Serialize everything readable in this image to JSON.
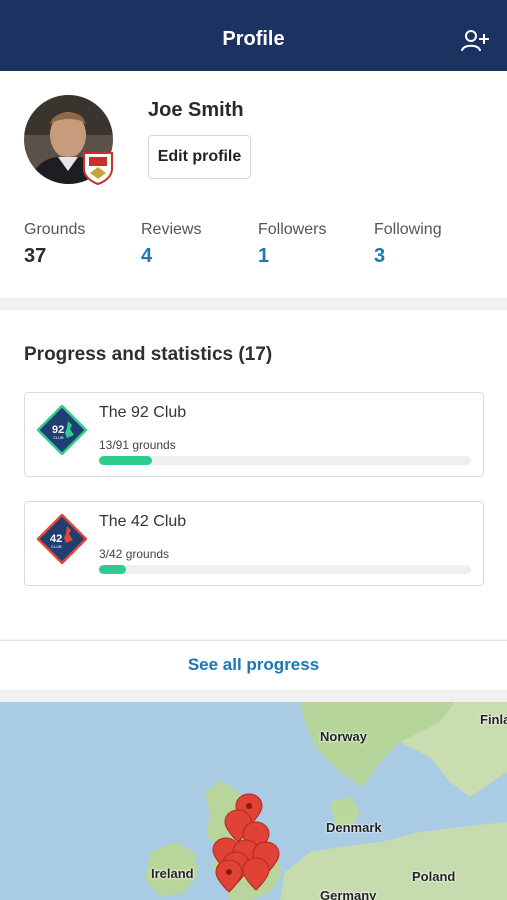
{
  "header": {
    "title": "Profile",
    "add_user_icon": "add-user-icon"
  },
  "profile": {
    "name": "Joe Smith",
    "edit_label": "Edit profile",
    "avatar_icon": "user-avatar",
    "badge_icon": "club-crest-icon"
  },
  "stats": [
    {
      "label": "Grounds",
      "value": "37",
      "style": "dark"
    },
    {
      "label": "Reviews",
      "value": "4",
      "style": "link"
    },
    {
      "label": "Followers",
      "value": "1",
      "style": "link"
    },
    {
      "label": "Following",
      "value": "3",
      "style": "link"
    }
  ],
  "progress": {
    "title": "Progress and statistics (17)",
    "clubs": [
      {
        "name": "The 92 Club",
        "count": "13/91 grounds",
        "done": 13,
        "total": 91,
        "badge": "92",
        "badge_color": "#1f3f73",
        "badge_border": "#2ecc8f",
        "icon": "92-club-badge-icon"
      },
      {
        "name": "The 42 Club",
        "count": "3/42 grounds",
        "done": 3,
        "total": 42,
        "badge": "42",
        "badge_color": "#1f3f73",
        "badge_border": "#e0463a",
        "icon": "42-club-badge-icon"
      }
    ],
    "see_all_label": "See all progress"
  },
  "map": {
    "labels": [
      "Norway",
      "Denmark",
      "Ireland",
      "Poland",
      "Germany",
      "Finla"
    ],
    "pin_color": "#e04235"
  },
  "colors": {
    "header_bg": "#1c3260",
    "link": "#1a78b4",
    "progress_fill": "#2ecc8f"
  }
}
